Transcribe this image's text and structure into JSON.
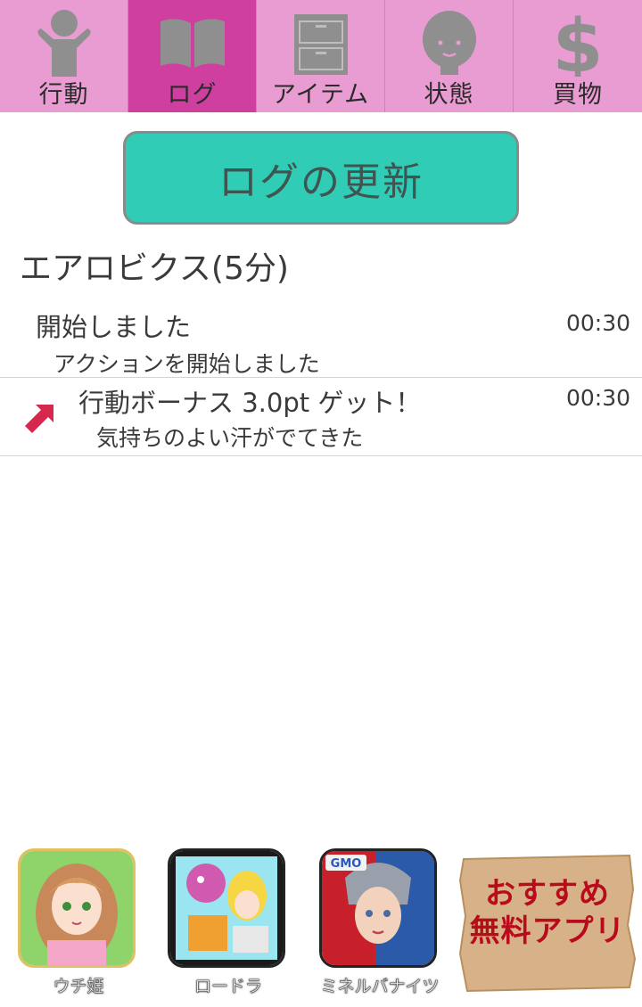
{
  "tabs": [
    {
      "label": "行動",
      "icon": "person-icon",
      "active": false
    },
    {
      "label": "ログ",
      "icon": "book-icon",
      "active": true
    },
    {
      "label": "アイテム",
      "icon": "drawer-icon",
      "active": false
    },
    {
      "label": "状態",
      "icon": "face-icon",
      "active": false
    },
    {
      "label": "買物",
      "icon": "dollar-icon",
      "active": false
    }
  ],
  "refresh_button": {
    "label": "ログの更新"
  },
  "log": {
    "section_title": "エアロビクス(5分)",
    "entries": [
      {
        "title": "開始しました",
        "desc": "アクションを開始しました",
        "time": "00:30"
      },
      {
        "title": "行動ボーナス 3.0pt ゲット！",
        "desc": "気持ちのよい汗がでてきた",
        "time": "00:30",
        "icon": "up-right-arrow-icon"
      }
    ]
  },
  "apps": [
    {
      "name": "ウチ姫"
    },
    {
      "name": "ロードラ"
    },
    {
      "name": "ミネルバナイツ",
      "badge": "GMO"
    }
  ],
  "promo": {
    "line1": "おすすめ",
    "line2": "無料アプリ"
  },
  "colors": {
    "tab_bg": "#e89cd2",
    "tab_active": "#cf3f9f",
    "button": "#31ccb5",
    "arrow": "#d6284f",
    "promo_text": "#b80c1c"
  }
}
